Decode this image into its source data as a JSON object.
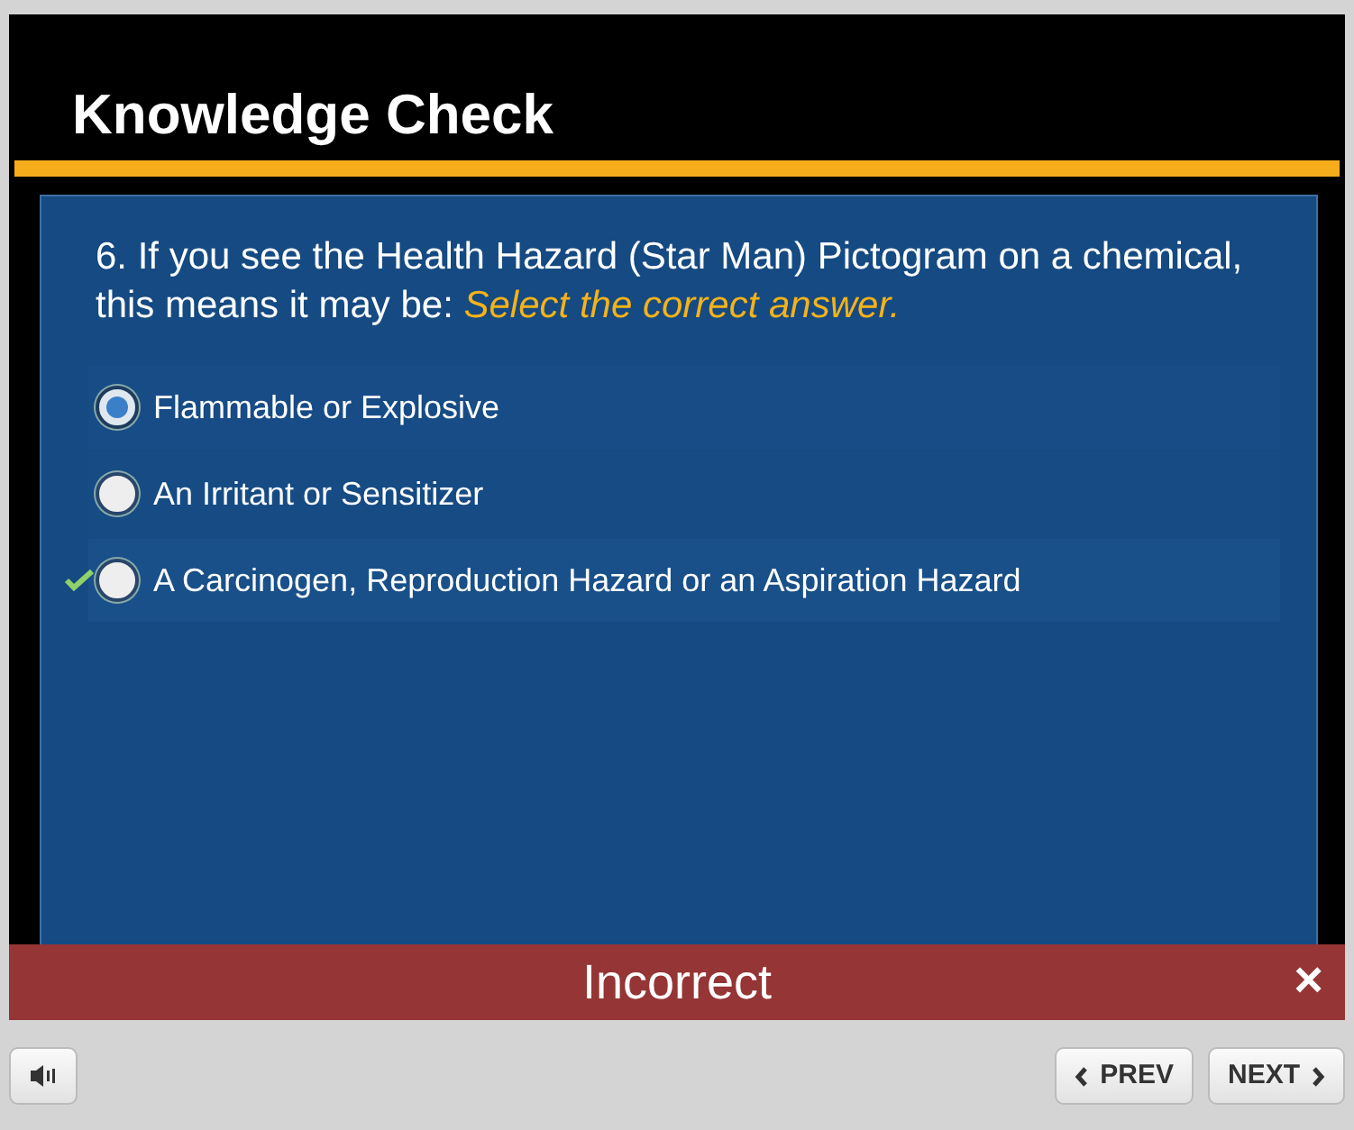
{
  "slide": {
    "title": "Knowledge Check",
    "question": {
      "text": "6. If you see the Health Hazard (Star Man) Pictogram on a chemical, this means it may be:",
      "instruction": "Select the correct answer."
    },
    "options": [
      {
        "label": "Flammable or Explosive",
        "selected": true,
        "correct": false
      },
      {
        "label": "An Irritant or Sensitizer",
        "selected": false,
        "correct": false
      },
      {
        "label": "A Carcinogen, Reproduction Hazard or an Aspiration Hazard",
        "selected": false,
        "correct": true
      }
    ]
  },
  "feedback": {
    "text": "Incorrect",
    "close": "×"
  },
  "player": {
    "prev": "PREV",
    "next": "NEXT"
  }
}
